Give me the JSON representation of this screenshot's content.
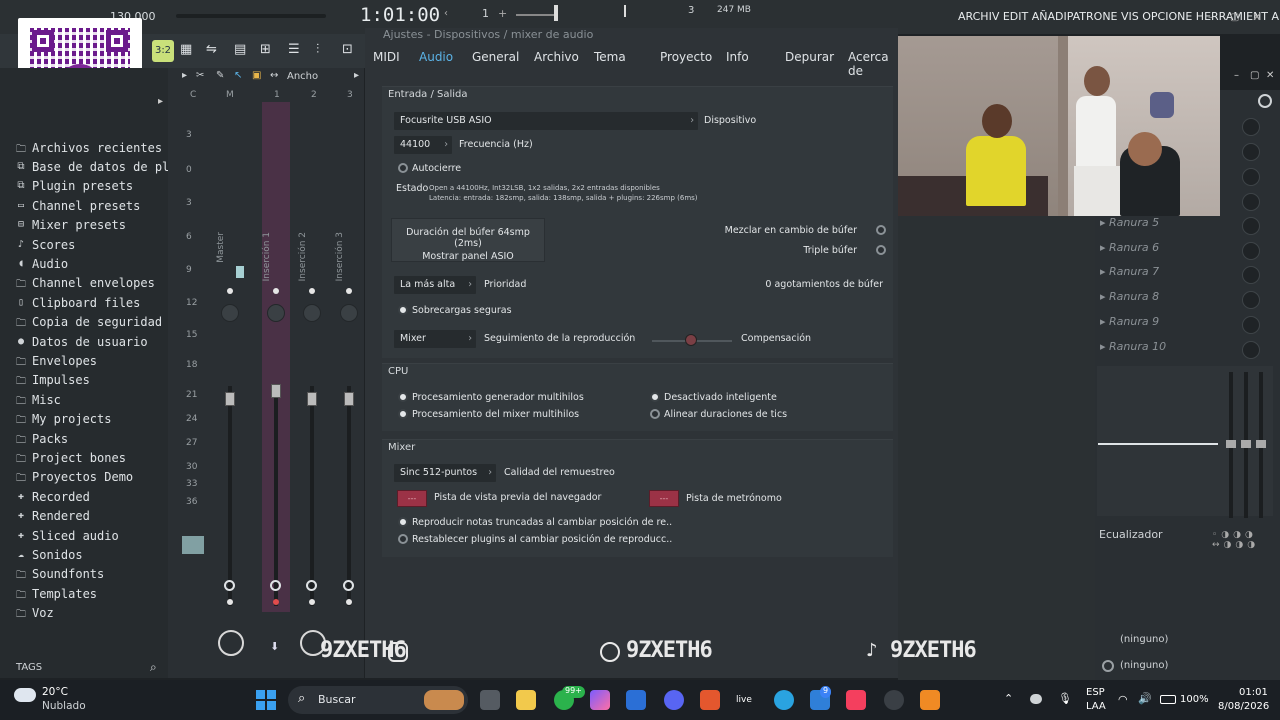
{
  "topbar": {
    "tempo": "130.000",
    "time": "1:01:00",
    "pattern": "1",
    "number3": "3",
    "memory": "247 MB",
    "title_right": "ARCHIV EDIT AÑADIPATRONE VIS OPCIONE HERRAMIENT A"
  },
  "browser": {
    "items": [
      {
        "label": "Archivos recientes",
        "icon": "folder-icon"
      },
      {
        "label": "Base de datos de plugins",
        "icon": "plug-icon"
      },
      {
        "label": "Plugin presets",
        "icon": "plug-icon"
      },
      {
        "label": "Channel presets",
        "icon": "channel-icon"
      },
      {
        "label": "Mixer presets",
        "icon": "mixer-icon"
      },
      {
        "label": "Scores",
        "icon": "note-icon"
      },
      {
        "label": "Audio",
        "icon": "speaker-icon"
      },
      {
        "label": "Channel envelopes",
        "icon": "folder-icon"
      },
      {
        "label": "Clipboard files",
        "icon": "clipboard-icon"
      },
      {
        "label": "Copia de seguridad",
        "icon": "folder-icon"
      },
      {
        "label": "Datos de usuario",
        "icon": "user-icon"
      },
      {
        "label": "Envelopes",
        "icon": "folder-icon"
      },
      {
        "label": "Impulses",
        "icon": "folder-icon"
      },
      {
        "label": "Misc",
        "icon": "folder-icon"
      },
      {
        "label": "My projects",
        "icon": "folder-icon"
      },
      {
        "label": "Packs",
        "icon": "folder-icon"
      },
      {
        "label": "Project bones",
        "icon": "folder-icon"
      },
      {
        "label": "Proyectos Demo",
        "icon": "folder-icon"
      },
      {
        "label": "Recorded",
        "icon": "plus-icon"
      },
      {
        "label": "Rendered",
        "icon": "plus-icon"
      },
      {
        "label": "Sliced audio",
        "icon": "plus-icon"
      },
      {
        "label": "Sonidos",
        "icon": "cloud-icon"
      },
      {
        "label": "Soundfonts",
        "icon": "folder-icon"
      },
      {
        "label": "Templates",
        "icon": "folder-icon"
      },
      {
        "label": "Voz",
        "icon": "folder-icon"
      }
    ],
    "tags_label": "TAGS"
  },
  "mixer": {
    "header_label": "Ancho",
    "tracks": [
      "Master",
      "Inserción 1",
      "Inserción 2",
      "Inserción 3"
    ],
    "column_heads": [
      "C",
      "M",
      "1",
      "2",
      "3"
    ],
    "scale": [
      "3",
      "0",
      "3",
      "6",
      "9",
      "12",
      "15",
      "18",
      "21",
      "24",
      "27",
      "30",
      "33",
      "36"
    ]
  },
  "settings": {
    "title": "Ajustes - Dispositivos / mixer de audio",
    "tabs": [
      "MIDI",
      "Audio",
      "General",
      "Archivo",
      "Tema",
      "Proyecto",
      "Info",
      "Depurar",
      "Acerca de"
    ],
    "io": {
      "title": "Entrada / Salida",
      "device": "Focusrite USB ASIO",
      "device_label": "Dispositivo",
      "frequency": "44100",
      "frequency_label": "Frecuencia (Hz)",
      "autoclose": "Autocierre",
      "status_label": "Estado",
      "status_line1": "Open a 44100Hz, Int32LSB, 1x2 salidas, 2x2 entradas disponibles",
      "status_line2": "Latencia: entrada: 182smp, salida: 138smp, salida + plugins: 226smp (6ms)",
      "buffer_line1": "Duración del búfer 64smp (2ms)",
      "buffer_line2": "Mostrar panel ASIO",
      "mix_buffer": "Mezclar en cambio de búfer",
      "triple_buffer": "Triple búfer",
      "priority_value": "La más alta",
      "priority_label": "Prioridad",
      "underruns": "0 agotamientos de búfer",
      "safe_overloads": "Sobrecargas seguras",
      "playback_value": "Mixer",
      "playback_label": "Seguimiento de la reproducción",
      "compensation": "Compensación"
    },
    "cpu": {
      "title": "CPU",
      "opt1": "Procesamiento generador multihilos",
      "opt2": "Procesamiento del mixer multihilos",
      "opt3": "Desactivado inteligente",
      "opt4": "Alinear duraciones de tics"
    },
    "mixer_section": {
      "title": "Mixer",
      "resample_value": "Sinc 512-puntos",
      "resample_label": "Calidad del remuestreo",
      "preview_btn": "---",
      "preview_label": "Pista de vista previa del navegador",
      "metronome_btn": "---",
      "metronome_label": "Pista de metrónomo",
      "opt1": "Reproducir notas truncadas al cambiar posición de re..",
      "opt2": "Restablecer plugins al cambiar posición de reproducc.."
    }
  },
  "right_panel": {
    "slots": [
      "Ranura 5",
      "Ranura 6",
      "Ranura 7",
      "Ranura 8",
      "Ranura 9",
      "Ranura 10"
    ],
    "eq_label": "Ecualizador",
    "send1": "(ninguno)",
    "send2": "(ninguno)"
  },
  "overlay": {
    "handle1": "9ZXETH6",
    "handle2": "9ZXETH6",
    "handle3": "9ZXETH6"
  },
  "taskbar": {
    "weather_temp": "20°C",
    "weather_desc": "Nublado",
    "search_placeholder": "Buscar",
    "badge1": "99+",
    "badge2": "9",
    "lang1": "ESP",
    "lang2": "LAA",
    "battery": "100%",
    "time": "01:01",
    "date": "8/08/2026"
  }
}
